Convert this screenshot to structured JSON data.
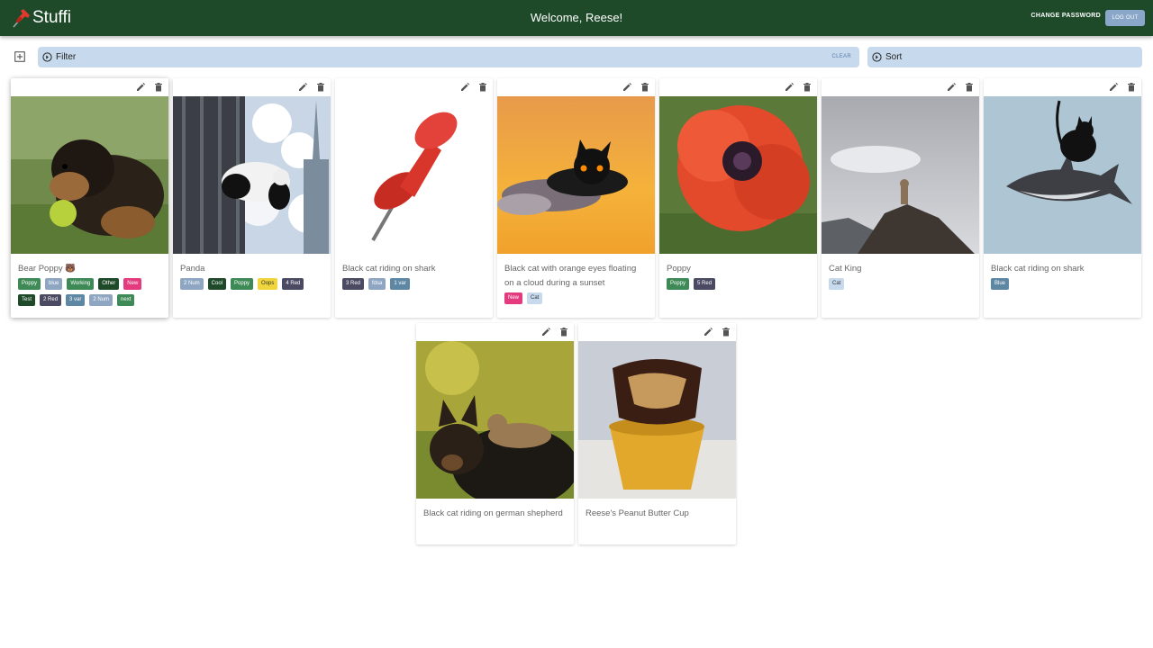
{
  "app": {
    "name": "Stuffi",
    "welcome": "Welcome, Reese!",
    "change_password": "CHANGE PASSWORD",
    "logout": "LOG OUT"
  },
  "toolbar": {
    "filter_label": "Filter",
    "clear_label": "CLEAR",
    "sort_label": "Sort"
  },
  "colors": {
    "topbar": "#1e4a2a",
    "bar": "#c7d9ec"
  },
  "cards": [
    {
      "title": "Bear Poppy 🐻",
      "image": "puppy-with-ball",
      "tags": [
        {
          "label": "Poppy",
          "color": "#3d8a56"
        },
        {
          "label": "blue",
          "color": "#8fa6c3"
        },
        {
          "label": "Working",
          "color": "#3d8a56"
        },
        {
          "label": "Other",
          "color": "#1e4a2a"
        },
        {
          "label": "New",
          "color": "#e33b7d"
        },
        {
          "label": "Test",
          "color": "#1e4a2a"
        },
        {
          "label": "2 Red",
          "color": "#4a4a63"
        },
        {
          "label": "3 var",
          "color": "#5d87a3"
        },
        {
          "label": "2 Num",
          "color": "#8fa6c3"
        },
        {
          "label": "next",
          "color": "#3d8a56"
        }
      ]
    },
    {
      "title": "Panda",
      "image": "panda-on-building",
      "tags": [
        {
          "label": "2 Num",
          "color": "#8fa6c3"
        },
        {
          "label": "Cool",
          "color": "#1e4a2a"
        },
        {
          "label": "Poppy",
          "color": "#3d8a56"
        },
        {
          "label": "Oops",
          "color": "#f0d63c",
          "text": "#333"
        },
        {
          "label": "4 Red",
          "color": "#4a4a63"
        }
      ]
    },
    {
      "title": "Black cat riding on shark",
      "image": "red-pushpin",
      "tags": [
        {
          "label": "3 Red",
          "color": "#4a4a63"
        },
        {
          "label": "fdsa",
          "color": "#8fa6c3"
        },
        {
          "label": "1 var",
          "color": "#5d87a3"
        }
      ]
    },
    {
      "title": "Black cat with orange eyes floating on a cloud during a sunset",
      "image": "cat-cloud-sunset",
      "tags": [
        {
          "label": "New",
          "color": "#e33b7d"
        },
        {
          "label": "Cat",
          "color": "#c7d9ec",
          "text": "#333"
        }
      ]
    },
    {
      "title": "Poppy",
      "image": "red-poppy-flower",
      "tags": [
        {
          "label": "Poppy",
          "color": "#3d8a56"
        },
        {
          "label": "5 Red",
          "color": "#4a4a63"
        }
      ]
    },
    {
      "title": "Cat King",
      "image": "cat-on-rock",
      "tags": [
        {
          "label": "Cat",
          "color": "#c7d9ec",
          "text": "#333"
        }
      ]
    },
    {
      "title": "Black cat riding on shark",
      "image": "cat-on-shark",
      "tags": [
        {
          "label": "Blue",
          "color": "#5d87a3"
        }
      ]
    },
    {
      "title": "Black cat riding on german shepherd",
      "image": "cat-on-german-shepherd",
      "tags": []
    },
    {
      "title": "Reese's Peanut Butter Cup",
      "image": "peanut-butter-cup",
      "tags": []
    }
  ]
}
